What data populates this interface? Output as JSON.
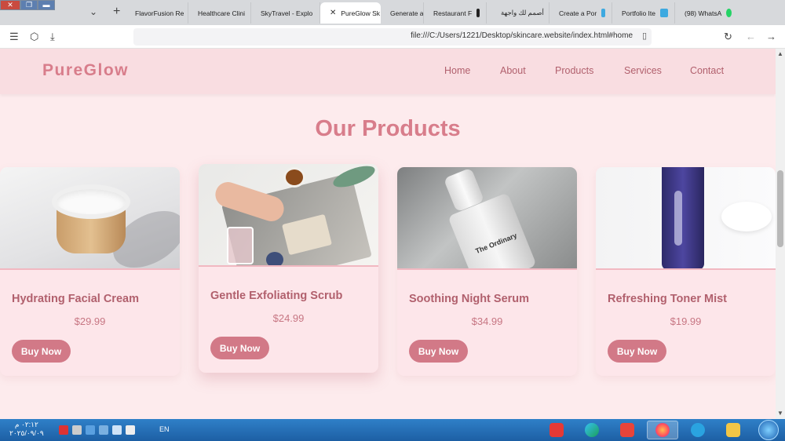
{
  "browser": {
    "tabs": [
      {
        "label": "FlavorFusion Re",
        "fav_color": "#00000000"
      },
      {
        "label": "Healthcare Clini",
        "fav_color": "#00000000"
      },
      {
        "label": "SkyTravel - Explo",
        "fav_color": "#00000000"
      },
      {
        "label": "PureGlow Sk",
        "fav_color": "#00000000",
        "active": true
      },
      {
        "label": "Generate a",
        "fav_color": "#111111"
      },
      {
        "label": "Restaurant F",
        "fav_color": "#222222"
      },
      {
        "label": "أصمم لك واجهة",
        "fav_color": "#f0b323"
      },
      {
        "label": "Create a Por",
        "fav_color": "#3da9e0"
      },
      {
        "label": "Portfolio Ite",
        "fav_color": "#3da9e0"
      },
      {
        "label": "(98) WhatsA",
        "fav_color": "#25d366"
      }
    ],
    "url": "file:///C:/Users/1221/Desktop/skincare.website/index.html#home"
  },
  "site": {
    "logo": "PureGlow",
    "nav": [
      "Home",
      "About",
      "Products",
      "Services",
      "Contact"
    ],
    "section_title": "Our Products",
    "products": [
      {
        "name": "Hydrating Facial Cream",
        "price": "$29.99",
        "button": "Buy Now"
      },
      {
        "name": "Gentle Exfoliating Scrub",
        "price": "$24.99",
        "button": "Buy Now"
      },
      {
        "name": "Soothing Night Serum",
        "price": "$34.99",
        "button": "Buy Now"
      },
      {
        "name": "Refreshing Toner Mist",
        "price": "$19.99",
        "button": "Buy Now"
      }
    ],
    "serum_label": "The Ordinary"
  },
  "taskbar": {
    "time": "٠٢:١٢ م",
    "date": "٢٠٢٥/٠٩/٠٩",
    "lang": "EN"
  },
  "colors": {
    "brand": "#d87d8b",
    "accent": "#d27987",
    "page_bg": "#fdebed"
  }
}
